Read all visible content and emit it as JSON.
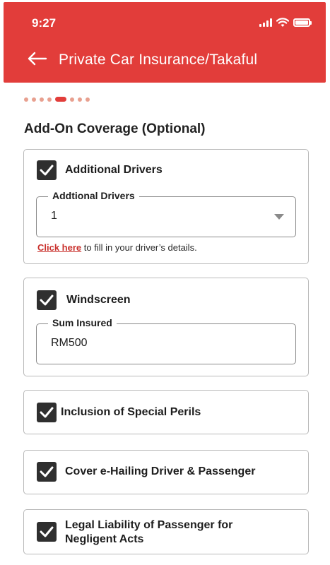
{
  "status_bar": {
    "time": "9:27"
  },
  "header": {
    "title": "Private Car Insurance/Takaful",
    "bg_color": "#e23d3a"
  },
  "stepper": {
    "total_steps": 7,
    "current_step": 5
  },
  "section": {
    "title": "Add-On Coverage (Optional)"
  },
  "addons": {
    "additional_drivers": {
      "label": "Additional Drivers",
      "checked": true,
      "field_label": "Addtional Drivers",
      "field_value": "1",
      "link_text": "Click here",
      "helper_text": " to fill in your driver’s details."
    },
    "windscreen": {
      "label": "Windscreen",
      "checked": true,
      "field_label": "Sum Insured",
      "field_value": "RM500"
    },
    "special_perils": {
      "label": "Inclusion of Special Perils",
      "checked": true
    },
    "e_hailing": {
      "label": "Cover e-Hailing Driver & Passenger",
      "checked": true
    },
    "legal_liability": {
      "label_line1": "Legal Liability of Passenger for",
      "label_line2": "Negligent Acts",
      "checked": true
    }
  }
}
